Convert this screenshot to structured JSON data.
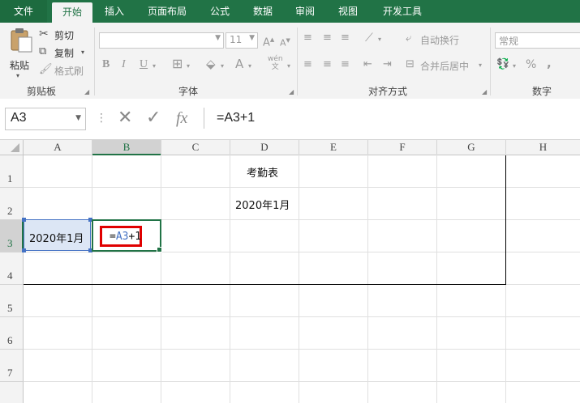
{
  "tabs": [
    {
      "label": "文件"
    },
    {
      "label": "开始"
    },
    {
      "label": "插入"
    },
    {
      "label": "页面布局"
    },
    {
      "label": "公式"
    },
    {
      "label": "数据"
    },
    {
      "label": "审阅"
    },
    {
      "label": "视图"
    },
    {
      "label": "开发工具"
    }
  ],
  "clipboard": {
    "paste": "粘贴",
    "cut": "剪切",
    "copy": "复制",
    "format_painter": "格式刷",
    "label": "剪贴板"
  },
  "font": {
    "size": "11",
    "bold": "B",
    "italic": "I",
    "underline": "U",
    "wen": "wén",
    "label": "字体"
  },
  "alignment": {
    "wrap_text": "自动换行",
    "merge_center": "合并后居中",
    "label": "对齐方式"
  },
  "number": {
    "format": "常规",
    "percent": "%",
    "comma": ",",
    "label": "数字"
  },
  "formula_bar": {
    "name_box": "A3",
    "formula": "=A3+1",
    "fx": "fx"
  },
  "columns": [
    "A",
    "B",
    "C",
    "D",
    "E",
    "F",
    "G",
    "H"
  ],
  "rows": [
    "1",
    "2",
    "3",
    "4",
    "5",
    "6",
    "7"
  ],
  "cells": {
    "D1": "考勤表",
    "D2": "2020年1月",
    "A3": "2020年1月",
    "B3_eq": "=",
    "B3_ref": "A3",
    "B3_rest": "+1"
  },
  "colors": {
    "excel_green": "#217346",
    "ref_blue": "#4472c4",
    "highlight_red": "#e00000"
  }
}
